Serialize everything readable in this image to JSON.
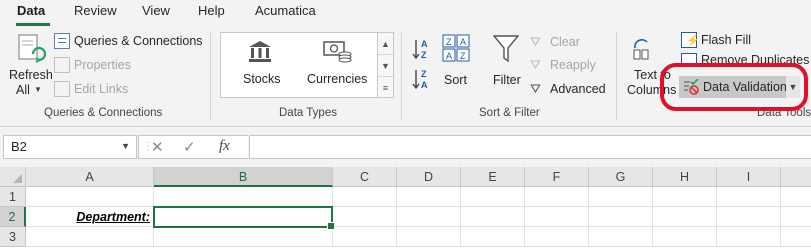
{
  "tabs": [
    {
      "label": "Data",
      "active": true
    },
    {
      "label": "Review"
    },
    {
      "label": "View"
    },
    {
      "label": "Help"
    },
    {
      "label": "Acumatica"
    }
  ],
  "ribbon": {
    "queries": {
      "refresh_label": "Refresh",
      "refresh_sub": "All",
      "queries_connections": "Queries & Connections",
      "properties": "Properties",
      "edit_links": "Edit Links",
      "group_label": "Queries & Connections"
    },
    "data_types": {
      "stocks": "Stocks",
      "currencies": "Currencies",
      "group_label": "Data Types"
    },
    "sort_filter": {
      "sort": "Sort",
      "filter": "Filter",
      "clear": "Clear",
      "reapply": "Reapply",
      "advanced": "Advanced",
      "group_label": "Sort & Filter"
    },
    "data_tools": {
      "text_to": "Text to",
      "columns": "Columns",
      "flash_fill": "Flash Fill",
      "remove_duplicates": "Remove Duplicates",
      "data_validation": "Data Validation",
      "group_label": "Data Tools"
    }
  },
  "formula_bar": {
    "name_box": "B2",
    "cancel_glyph": "✕",
    "enter_glyph": "✓",
    "fx_glyph": "fx",
    "value": ""
  },
  "sheet": {
    "columns": [
      "A",
      "B",
      "C",
      "D",
      "E",
      "F",
      "G",
      "H",
      "I"
    ],
    "selected_column": "B",
    "rows": [
      "1",
      "2",
      "3"
    ],
    "selected_row": "2",
    "cells": {
      "A2": "Department:",
      "B2": ""
    }
  },
  "colors": {
    "accent": "#217346",
    "highlight": "#e0102a"
  }
}
